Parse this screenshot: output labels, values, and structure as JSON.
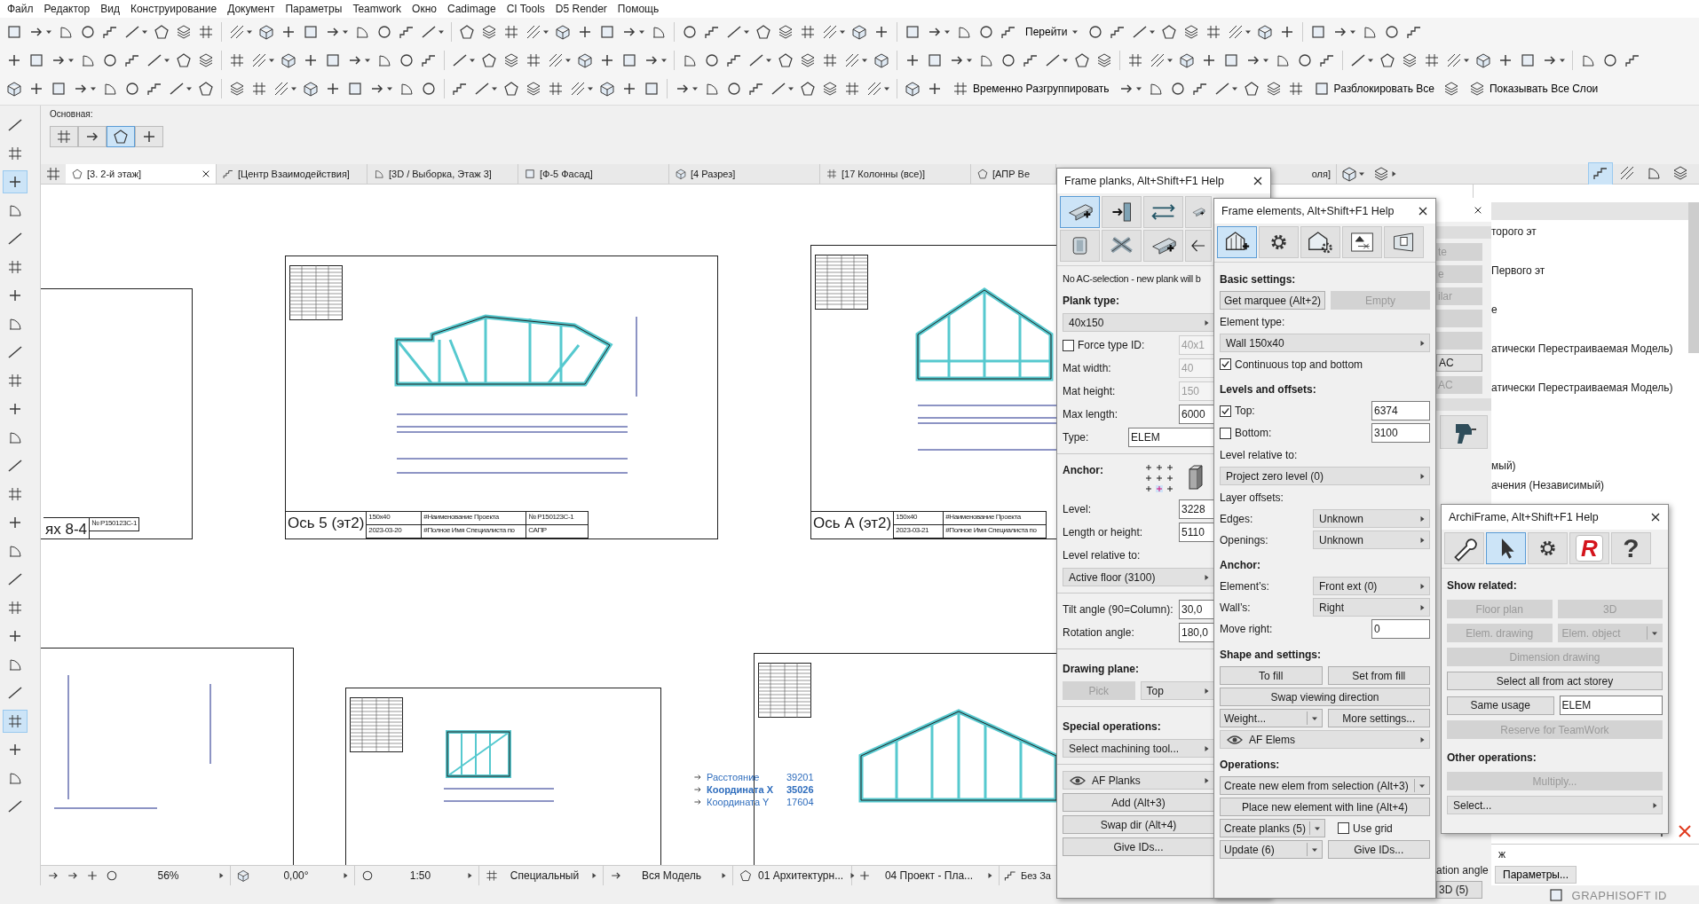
{
  "menu": [
    "Файл",
    "Редактор",
    "Вид",
    "Конструирование",
    "Документ",
    "Параметры",
    "Teamwork",
    "Окно",
    "Cadimage",
    "CI Tools",
    "D5 Render",
    "Помощь"
  ],
  "toolbar_buttons": [
    {
      "label": "Перейти"
    },
    {
      "label": "Временно Разгруппировать"
    },
    {
      "label": "Разблокировать Все"
    },
    {
      "label": "Показывать Все Слои"
    }
  ],
  "info_box": {
    "label": "Основная:",
    "tools": [
      {
        "selected": false
      },
      {
        "selected": false
      },
      {
        "selected": true
      },
      {
        "selected": false
      }
    ]
  },
  "toolbox": [
    {
      "selected": false
    },
    {
      "selected": false
    },
    {
      "selected": true
    },
    {
      "selected": false
    },
    {
      "selected": false
    },
    {
      "selected": false
    },
    {
      "selected": false
    },
    {
      "selected": false
    },
    {
      "selected": false
    },
    {
      "selected": false
    },
    {
      "selected": false
    },
    {
      "selected": false
    },
    {
      "selected": false
    },
    {
      "selected": false
    },
    {
      "selected": false
    },
    {
      "selected": false
    },
    {
      "selected": false
    },
    {
      "selected": false
    },
    {
      "selected": false
    },
    {
      "selected": false
    },
    {
      "selected": false
    },
    {
      "selected": true
    },
    {
      "selected": false
    },
    {
      "selected": false
    },
    {
      "selected": false
    }
  ],
  "tabs": [
    {
      "label": "[3. 2-й этаж]",
      "selected": true
    },
    {
      "label": "[Центр Взаимодействия]",
      "selected": false
    },
    {
      "label": "[3D / Выборка, Этаж 3]",
      "selected": false
    },
    {
      "label": "[Ф-5 Фасад]",
      "selected": false
    },
    {
      "label": "[4 Разрез]",
      "selected": false
    },
    {
      "label": "[17 Колонны (все)]",
      "selected": false
    },
    {
      "label": "[АПР Ве",
      "selected": false
    },
    {
      "label": "оля]",
      "selected": false
    }
  ],
  "navigator_views": [
    {
      "selected": true
    },
    {
      "selected": false
    },
    {
      "selected": false
    },
    {
      "selected": false
    }
  ],
  "navigator": {
    "items": [
      "торого эт",
      "Первого эт",
      "е",
      "атически Перестраиваемая Модель)",
      "атически Перестраиваемая Модель)",
      "мый)",
      "ачения (Независимый)"
    ],
    "field": "ж",
    "button": "Параметры..."
  },
  "sheets": [
    {
      "title": "ях 8-4",
      "cells": [
        "№ Р150123С-1"
      ]
    },
    {
      "title": "Ось 5 (эт2)",
      "cells": [
        "150x40",
        "#Наименование Проекта",
        "№ Р150123С-1",
        "2023-03-20",
        "#Полное Имя Специалиста по",
        "САПР"
      ]
    },
    {
      "title": "Ось А (эт2)",
      "cells": [
        "150x40",
        "#Наименование Проекта",
        "2023-03-21",
        "#Полное Имя Специалиста по"
      ]
    }
  ],
  "coordinates": [
    {
      "label": "Расстояние",
      "value": "39201",
      "emphasized": false
    },
    {
      "label": "Координата X",
      "value": "35026",
      "emphasized": true
    },
    {
      "label": "Координата Y",
      "value": "17604",
      "emphasized": false
    }
  ],
  "status_bar": [
    {
      "text": "56%"
    },
    {
      "text": "0,00°"
    },
    {
      "text": "1:50"
    },
    {
      "text": "Специальный"
    },
    {
      "text": "Вся Модель"
    },
    {
      "text": "01 Архитектурн..."
    },
    {
      "text": "04 Проект - Пла..."
    },
    {
      "text": "Без За"
    }
  ],
  "palettes": [
    {
      "title": "Frame planks, Alt+Shift+F1 Help",
      "tabs": [
        {
          "selected": true
        },
        {
          "selected": false
        },
        {
          "selected": false
        },
        {
          "selected": false
        },
        {
          "selected": false
        },
        {
          "selected": false
        },
        {
          "selected": false
        },
        {
          "selected": false
        }
      ],
      "rows": [
        {
          "kind": "note",
          "text": "No AC-selection - new plank will b"
        },
        {
          "kind": "heading",
          "text": "Plank type:"
        },
        {
          "kind": "select",
          "value": "40x150"
        },
        {
          "kind": "check",
          "label": "Force type ID:",
          "checked": false,
          "value": "40x1",
          "disabled": true
        },
        {
          "kind": "field",
          "label": "Mat width:",
          "value": "40",
          "disabled": true
        },
        {
          "kind": "field",
          "label": "Mat height:",
          "value": "150",
          "disabled": true
        },
        {
          "kind": "field",
          "label": "Max length:",
          "value": "6000",
          "disabled": false
        },
        {
          "kind": "wide-field",
          "label": "Type:",
          "value": "ELEM"
        },
        {
          "kind": "divider"
        },
        {
          "kind": "anchor",
          "text": "Anchor:"
        },
        {
          "kind": "field",
          "label": "Level:",
          "value": "3228",
          "disabled": false
        },
        {
          "kind": "field",
          "label": "Length or height:",
          "value": "5110",
          "disabled": false
        },
        {
          "kind": "label",
          "text": "Level relative to:"
        },
        {
          "kind": "select",
          "value": "Active floor (3100)"
        },
        {
          "kind": "divider"
        },
        {
          "kind": "field",
          "label": "Tilt angle (90=Column):",
          "value": "30,0",
          "disabled": false
        },
        {
          "kind": "field",
          "label": "Rotation angle:",
          "value": "180,0",
          "disabled": false
        },
        {
          "kind": "divider"
        },
        {
          "kind": "heading",
          "text": "Drawing plane:"
        },
        {
          "kind": "buttons",
          "items": [
            {
              "kind": "button",
              "label": "Pick",
              "disabled": true,
              "split": false
            },
            {
              "kind": "select",
              "label": "Top"
            }
          ]
        },
        {
          "kind": "divider"
        },
        {
          "kind": "heading",
          "text": "Special operations:"
        },
        {
          "kind": "select",
          "value": "Select machining tool..."
        },
        {
          "kind": "divider"
        },
        {
          "kind": "layer",
          "text": "AF Planks"
        },
        {
          "kind": "buttons",
          "items": [
            {
              "kind": "button",
              "label": "Add (Alt+3)",
              "disabled": false,
              "split": false
            }
          ]
        },
        {
          "kind": "buttons",
          "items": [
            {
              "kind": "button",
              "label": "Swap dir (Alt+4)",
              "disabled": false,
              "split": false
            }
          ]
        },
        {
          "kind": "buttons",
          "items": [
            {
              "kind": "button",
              "label": "Give IDs...",
              "disabled": false,
              "split": false
            }
          ]
        }
      ]
    },
    {
      "title": "Frame elements, Alt+Shift+F1 Help",
      "tabs": [
        {
          "selected": true
        },
        {
          "selected": false
        },
        {
          "selected": false
        },
        {
          "selected": false
        },
        {
          "selected": false
        }
      ],
      "rows": [
        {
          "kind": "heading",
          "text": "Basic settings:"
        },
        {
          "kind": "buttons",
          "items": [
            {
              "kind": "button",
              "label": "Get marquee (Alt+2)",
              "disabled": false,
              "split": false
            },
            {
              "kind": "button",
              "label": "Empty",
              "disabled": true,
              "split": false
            }
          ]
        },
        {
          "kind": "label",
          "text": "Element type:"
        },
        {
          "kind": "select",
          "value": "Wall 150x40"
        },
        {
          "kind": "check",
          "label": "Continuous top and bottom",
          "checked": true
        },
        {
          "kind": "heading",
          "text": "Levels and offsets:"
        },
        {
          "kind": "check",
          "label": "Top:",
          "checked": true,
          "value": "6374",
          "disabled": false
        },
        {
          "kind": "check",
          "label": "Bottom:",
          "checked": false,
          "value": "3100",
          "disabled": false
        },
        {
          "kind": "label",
          "text": "Level relative to:"
        },
        {
          "kind": "select",
          "value": "Project zero level (0)"
        },
        {
          "kind": "label",
          "text": "Layer offsets:"
        },
        {
          "kind": "select-field",
          "label": "Edges:",
          "value": "Unknown"
        },
        {
          "kind": "select-field",
          "label": "Openings:",
          "value": "Unknown"
        },
        {
          "kind": "heading",
          "text": "Anchor:"
        },
        {
          "kind": "select-field",
          "label": "Element’s:",
          "value": "Front ext (0)"
        },
        {
          "kind": "select-field",
          "label": "Wall’s:",
          "value": "Right"
        },
        {
          "kind": "field",
          "label": "Move right:",
          "value": "0",
          "disabled": false
        },
        {
          "kind": "heading",
          "text": "Shape and settings:"
        },
        {
          "kind": "buttons",
          "items": [
            {
              "kind": "button",
              "label": "To fill",
              "disabled": false,
              "split": false
            },
            {
              "kind": "button",
              "label": "Set from fill",
              "disabled": false,
              "split": false
            }
          ]
        },
        {
          "kind": "buttons",
          "items": [
            {
              "kind": "button",
              "label": "Swap viewing direction",
              "disabled": false,
              "split": false
            }
          ]
        },
        {
          "kind": "buttons",
          "items": [
            {
              "kind": "button",
              "label": "Weight...",
              "disabled": false,
              "split": true
            },
            {
              "kind": "button",
              "label": "More settings...",
              "disabled": false,
              "split": false
            }
          ]
        },
        {
          "kind": "layer",
          "text": "AF Elems"
        },
        {
          "kind": "heading",
          "text": "Operations:"
        },
        {
          "kind": "buttons",
          "items": [
            {
              "kind": "button",
              "label": "Create new elem from selection (Alt+3)",
              "disabled": false,
              "split": true
            }
          ]
        },
        {
          "kind": "buttons",
          "items": [
            {
              "kind": "button",
              "label": "Place new element with line (Alt+4)",
              "disabled": false,
              "split": false
            }
          ]
        },
        {
          "kind": "buttons",
          "items": [
            {
              "kind": "button",
              "label": "Create planks (5)",
              "disabled": false,
              "split": true
            },
            {
              "kind": "checkbox",
              "label": "Use grid",
              "checked": false
            }
          ]
        },
        {
          "kind": "buttons",
          "items": [
            {
              "kind": "button",
              "label": "Update (6)",
              "disabled": false,
              "split": true
            },
            {
              "kind": "button",
              "label": "Give IDs...",
              "disabled": false,
              "split": false
            }
          ]
        }
      ]
    },
    {
      "title": "ArchiFrame, Alt+Shift+F1 Help",
      "tabs": [
        {
          "selected": false
        },
        {
          "selected": true
        },
        {
          "selected": false
        },
        {
          "selected": false,
          "glyph": "R"
        },
        {
          "selected": false,
          "glyph": "?"
        }
      ],
      "rows": [
        {
          "kind": "heading",
          "text": "Show related:"
        },
        {
          "kind": "buttons",
          "items": [
            {
              "kind": "button",
              "label": "Floor plan",
              "disabled": true,
              "split": false
            },
            {
              "kind": "button",
              "label": "3D",
              "disabled": true,
              "split": false
            }
          ]
        },
        {
          "kind": "buttons",
          "items": [
            {
              "kind": "button",
              "label": "Elem. drawing",
              "disabled": true,
              "split": false
            },
            {
              "kind": "button",
              "label": "Elem. object",
              "disabled": true,
              "split": true
            }
          ]
        },
        {
          "kind": "buttons",
          "items": [
            {
              "kind": "button",
              "label": "Dimension drawing",
              "disabled": true,
              "split": false
            }
          ]
        },
        {
          "kind": "buttons",
          "items": [
            {
              "kind": "button",
              "label": "Select all from act storey",
              "disabled": false,
              "split": false
            }
          ]
        },
        {
          "kind": "buttons",
          "items": [
            {
              "kind": "button",
              "label": "Same usage",
              "disabled": false,
              "split": false
            },
            {
              "kind": "input",
              "label": "ELEM"
            }
          ]
        },
        {
          "kind": "buttons",
          "items": [
            {
              "kind": "button",
              "label": "Reserve for TeamWork",
              "disabled": true,
              "split": false
            }
          ]
        },
        {
          "kind": "heading",
          "text": "Other operations:"
        },
        {
          "kind": "buttons",
          "items": [
            {
              "kind": "button",
              "label": "Multiply...",
              "disabled": true,
              "split": false
            }
          ]
        },
        {
          "kind": "select",
          "value": "Select..."
        }
      ]
    }
  ],
  "back_palette": {
    "items": [
      {
        "kind": "band"
      },
      {
        "kind": "button",
        "label": "te",
        "disabled": true
      },
      {
        "kind": "button",
        "label": "e",
        "disabled": true
      },
      {
        "kind": "button",
        "label": "ilar",
        "disabled": true
      },
      {
        "kind": "button",
        "disabled": true
      },
      {
        "kind": "button",
        "disabled": true
      },
      {
        "kind": "button",
        "label": "AC",
        "disabled": false
      },
      {
        "kind": "button",
        "label": "AC",
        "disabled": true
      },
      {
        "kind": "band"
      },
      {
        "kind": "tool"
      },
      {
        "kind": "spacer"
      },
      {
        "kind": "label",
        "label": "ation angle"
      },
      {
        "kind": "button",
        "label": "3D (5)",
        "disabled": false
      }
    ]
  },
  "footer": {
    "text": "GRAPHISOFT ID"
  }
}
